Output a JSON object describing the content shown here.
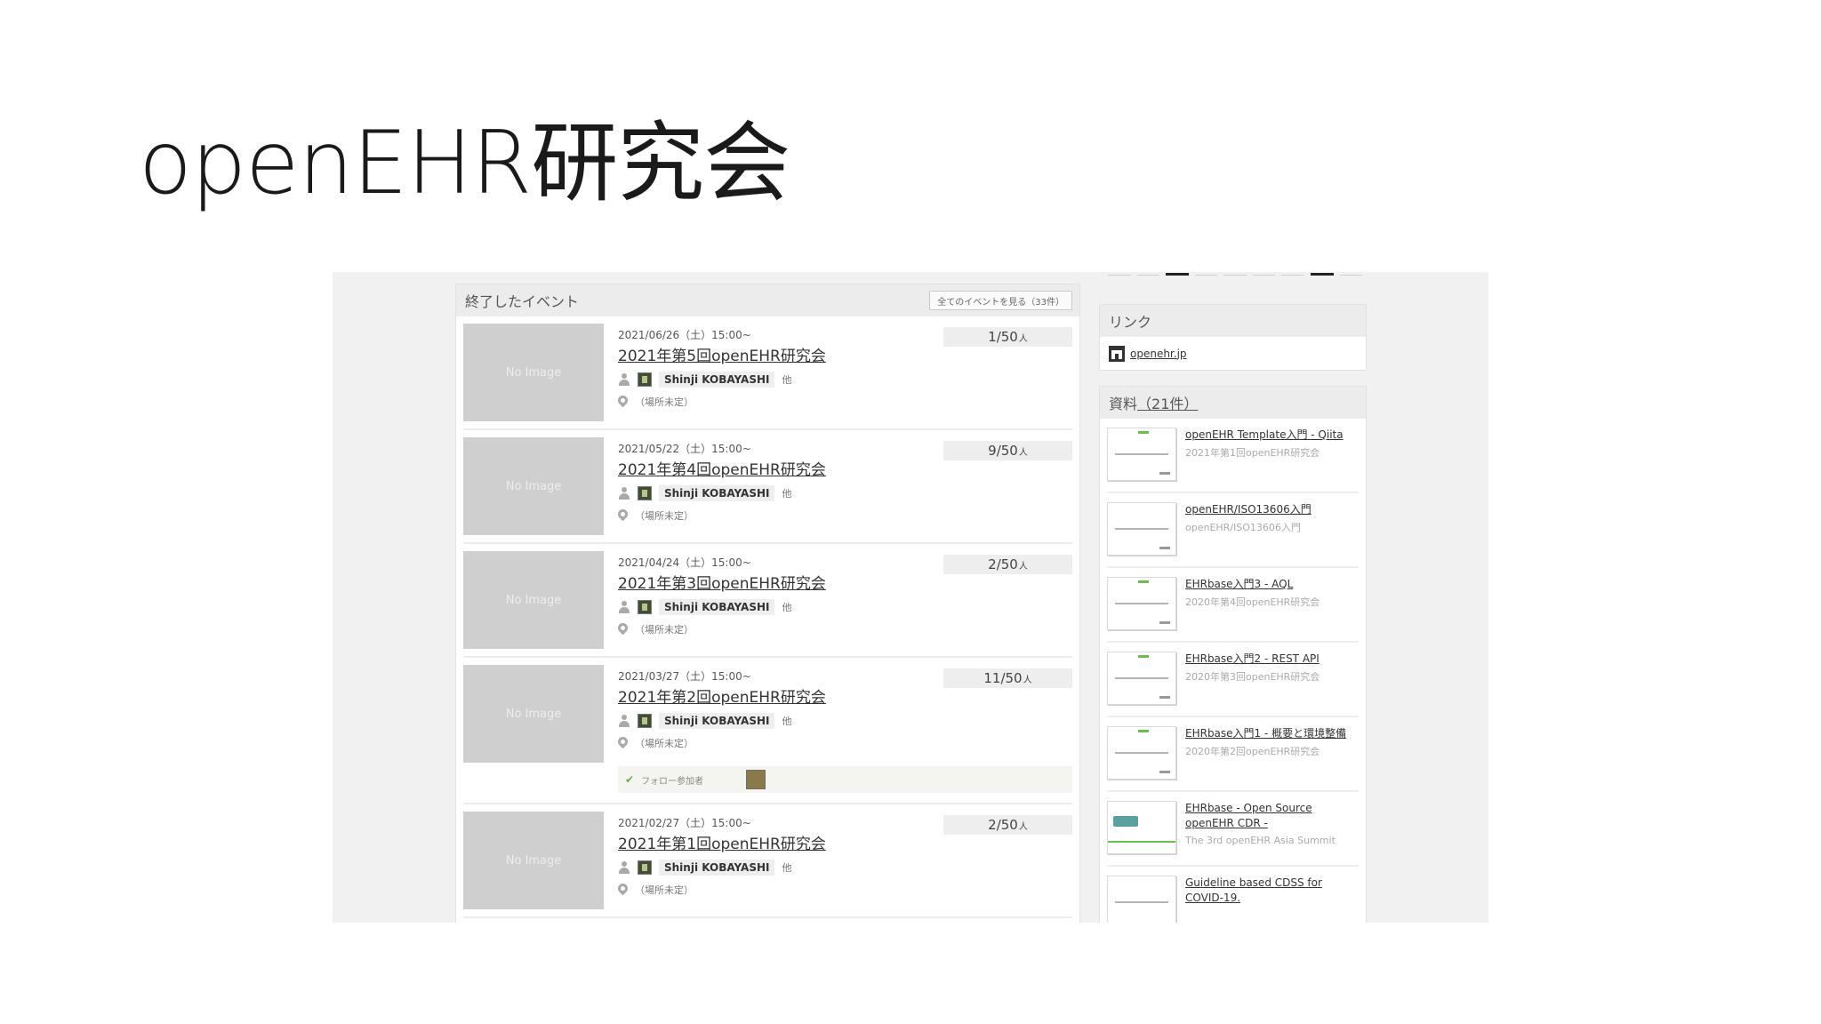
{
  "slide": {
    "title": "openEHR研究会"
  },
  "events": {
    "header": "終了したイベント",
    "all_events_button": "全てのイベントを見る（33件）",
    "items": [
      {
        "date": "2021/06/26（土）15:00~",
        "title": "2021年第5回openEHR研究会",
        "owner": "Shinji KOBAYASHI",
        "owner_suffix": "他",
        "place": "（場所未定）",
        "count": "1/50",
        "unit": "人",
        "image_label": "No Image"
      },
      {
        "date": "2021/05/22（土）15:00~",
        "title": "2021年第4回openEHR研究会",
        "owner": "Shinji KOBAYASHI",
        "owner_suffix": "他",
        "place": "（場所未定）",
        "count": "9/50",
        "unit": "人",
        "image_label": "No Image"
      },
      {
        "date": "2021/04/24（土）15:00~",
        "title": "2021年第3回openEHR研究会",
        "owner": "Shinji KOBAYASHI",
        "owner_suffix": "他",
        "place": "（場所未定）",
        "count": "2/50",
        "unit": "人",
        "image_label": "No Image"
      },
      {
        "date": "2021/03/27（土）15:00~",
        "title": "2021年第2回openEHR研究会",
        "owner": "Shinji KOBAYASHI",
        "owner_suffix": "他",
        "place": "（場所未定）",
        "count": "11/50",
        "unit": "人",
        "image_label": "No Image",
        "follow_label": "フォロー参加者"
      },
      {
        "date": "2021/02/27（土）15:00~",
        "title": "2021年第1回openEHR研究会",
        "owner": "Shinji KOBAYASHI",
        "owner_suffix": "他",
        "place": "（場所未定）",
        "count": "2/50",
        "unit": "人",
        "image_label": "No Image"
      }
    ]
  },
  "links": {
    "header": "リンク",
    "items": [
      {
        "label": "openehr.jp",
        "icon": "home-icon"
      }
    ]
  },
  "materials": {
    "header": "資料",
    "count": "（21件）",
    "items": [
      {
        "title": "openEHR Template入門 - Qiita",
        "sub": "2021年第1回openEHR研究会"
      },
      {
        "title": "openEHR/ISO13606入門",
        "sub": "openEHR/ISO13606入門"
      },
      {
        "title": "EHRbase入門3 - AQL",
        "sub": "2020年第4回openEHR研究会"
      },
      {
        "title": "EHRbase入門2 - REST API",
        "sub": "2020年第3回openEHR研究会"
      },
      {
        "title": "EHRbase入門1 - 概要と環境整備",
        "sub": "2020年第2回openEHR研究会"
      },
      {
        "title": "EHRbase - Open Source openEHR CDR -",
        "sub": "The 3rd openEHR Asia Summit"
      },
      {
        "title": "Guideline based CDSS for COVID-19.",
        "sub": ""
      }
    ]
  },
  "colors": {
    "panel_header": "#ececec",
    "no_image": "#cfcfcf",
    "accent_green": "#6bbf4e"
  }
}
